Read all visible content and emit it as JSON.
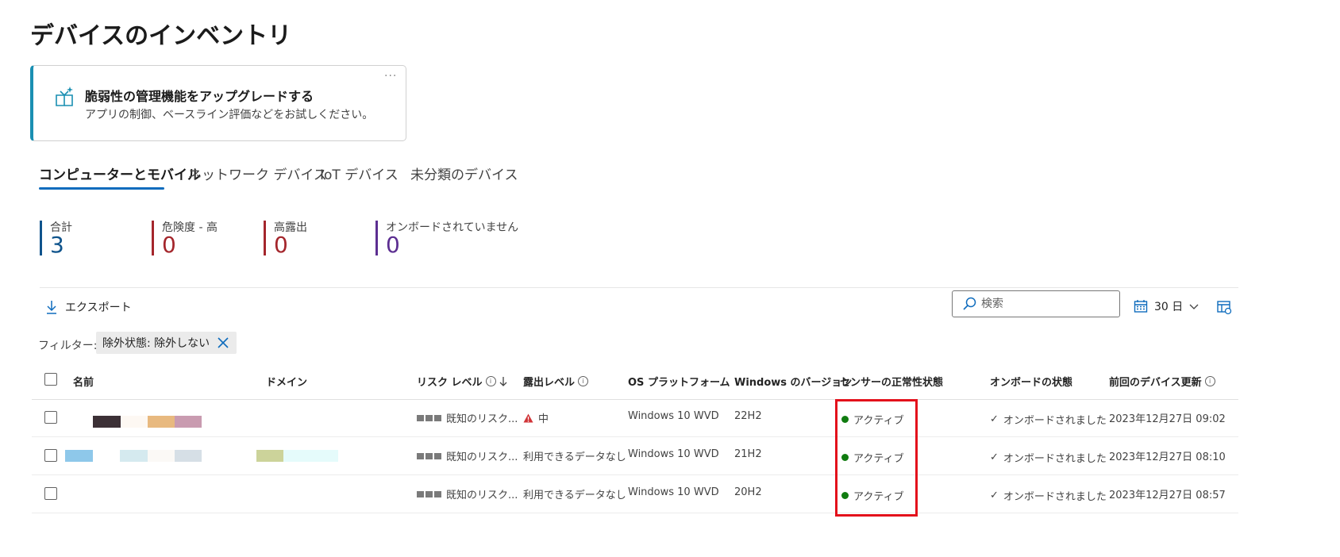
{
  "page": {
    "title": "デバイスのインベントリ"
  },
  "banner": {
    "title": "脆弱性の管理機能をアップグレードする",
    "subtitle": "アプリの制御、ベースライン評価などをお試しください。",
    "more_label": "···",
    "icon": "sparkle-upgrade-icon"
  },
  "tabs": [
    {
      "label": "コンピューターとモバイル",
      "active": true
    },
    {
      "label": "ネットワーク デバイス",
      "active": false
    },
    {
      "label": "IoT デバイス",
      "active": false
    },
    {
      "label": "未分類のデバイス",
      "active": false
    }
  ],
  "stats": [
    {
      "label": "合計",
      "value": "3",
      "color": "#0f548c"
    },
    {
      "label": "危険度 - 高",
      "value": "0",
      "color": "#a4262c"
    },
    {
      "label": "高露出",
      "value": "0",
      "color": "#a4262c"
    },
    {
      "label": "オンボードされていません",
      "value": "0",
      "color": "#5c2e91"
    }
  ],
  "toolbar": {
    "export_label": "エクスポート",
    "search_placeholder": "検索",
    "date_range": "30 日"
  },
  "filter": {
    "label": "フィルター:",
    "chip": "除外状態: 除外しない"
  },
  "table": {
    "headers": {
      "name": "名前",
      "domain": "ドメイン",
      "risk": "リスク レベル",
      "exposure": "露出レベル",
      "os": "OS プラットフォーム",
      "winver": "Windows のバージョン",
      "sensor": "センサーの正常性状態",
      "onboard": "オンボードの状態",
      "lastupdate": "前回のデバイス更新"
    },
    "rows": [
      {
        "risk": "既知のリスク...",
        "exposure": "中",
        "exposure_icon": "warning-triangle-icon",
        "os": "Windows 10 WVD",
        "winver": "22H2",
        "sensor": "アクティブ",
        "onboard": "オンボードされました",
        "lastupdate": "2023年12月27日 09:02"
      },
      {
        "risk": "既知のリスク...",
        "exposure": "利用できるデータなし",
        "os": "Windows 10 WVD",
        "winver": "21H2",
        "sensor": "アクティブ",
        "onboard": "オンボードされました",
        "lastupdate": "2023年12月27日 08:10"
      },
      {
        "risk": "既知のリスク...",
        "exposure": "利用できるデータなし",
        "os": "Windows 10 WVD",
        "winver": "20H2",
        "sensor": "アクティブ",
        "onboard": "オンボードされました",
        "lastupdate": "2023年12月27日 08:57"
      }
    ]
  },
  "colors": {
    "accent": "#0f6cbd",
    "banner_accent": "#1a8fb2",
    "active_status": "#107c10",
    "highlight": "#e3101b",
    "warning": "#d13438"
  }
}
